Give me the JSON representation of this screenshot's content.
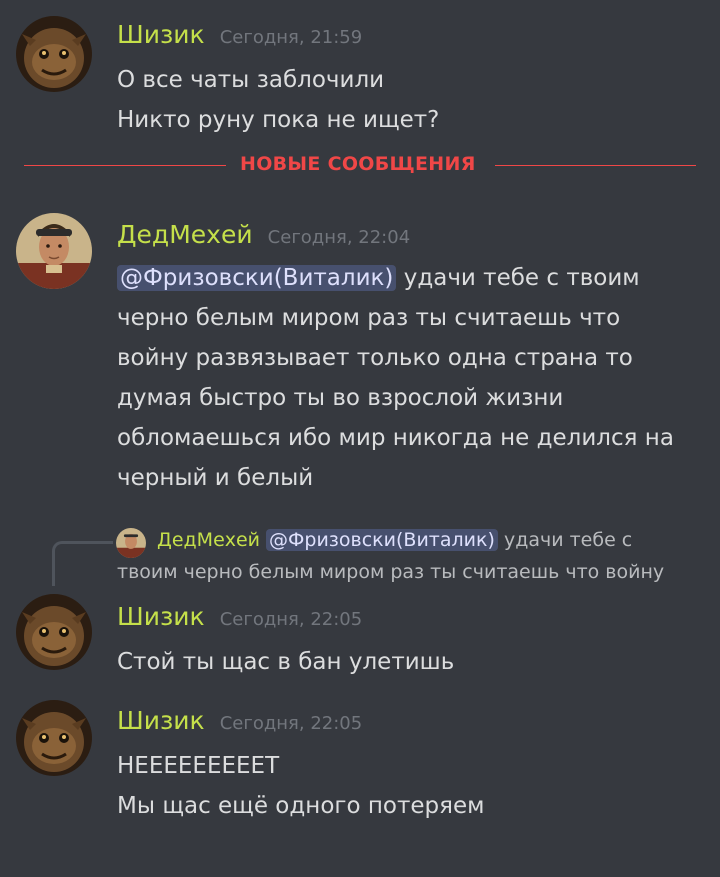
{
  "colors": {
    "background": "#36393f",
    "author": "#c5e04a",
    "timestamp": "#72767d",
    "new_messages": "#f04747",
    "mention_bg": "#4a5289"
  },
  "messages": [
    {
      "author": "Шизик",
      "timestamp": "Сегодня, 21:59",
      "avatar_icon": "goblin-avatar-icon",
      "lines": [
        "О все чаты заблочили",
        "Никто руну пока не ищет?"
      ]
    },
    {
      "author": "ДедМехей",
      "timestamp": "Сегодня, 22:04",
      "avatar_icon": "man-avatar-icon",
      "mention": "@Фризовски(Виталик)",
      "first_line_rest": "удачи тебе с твоим",
      "lines": [
        "черно белым миром раз ты считаешь что",
        "войну развязывает только одна страна то",
        "думая быстро ты во взрослой жизни",
        "обломаешься ибо мир никогда не делился на",
        "черный и белый"
      ]
    },
    {
      "author": "Шизик",
      "timestamp": "Сегодня, 22:05",
      "avatar_icon": "goblin-avatar-icon",
      "lines": [
        "Стой ты щас в бан улетишь"
      ],
      "reply": {
        "author": "ДедМехей",
        "mention": "@Фризовски(Виталик)",
        "text_rest": "удачи тебе с",
        "text_line2": "твоим черно белым миром раз ты считаешь что войну"
      }
    },
    {
      "author": "Шизик",
      "timestamp": "Сегодня, 22:05",
      "avatar_icon": "goblin-avatar-icon",
      "lines": [
        "НЕЕЕЕЕЕЕЕЕТ",
        "Мы щас ещё одного потеряем"
      ]
    }
  ],
  "divider": {
    "label": "НОВЫЕ СООБЩЕНИЯ"
  }
}
